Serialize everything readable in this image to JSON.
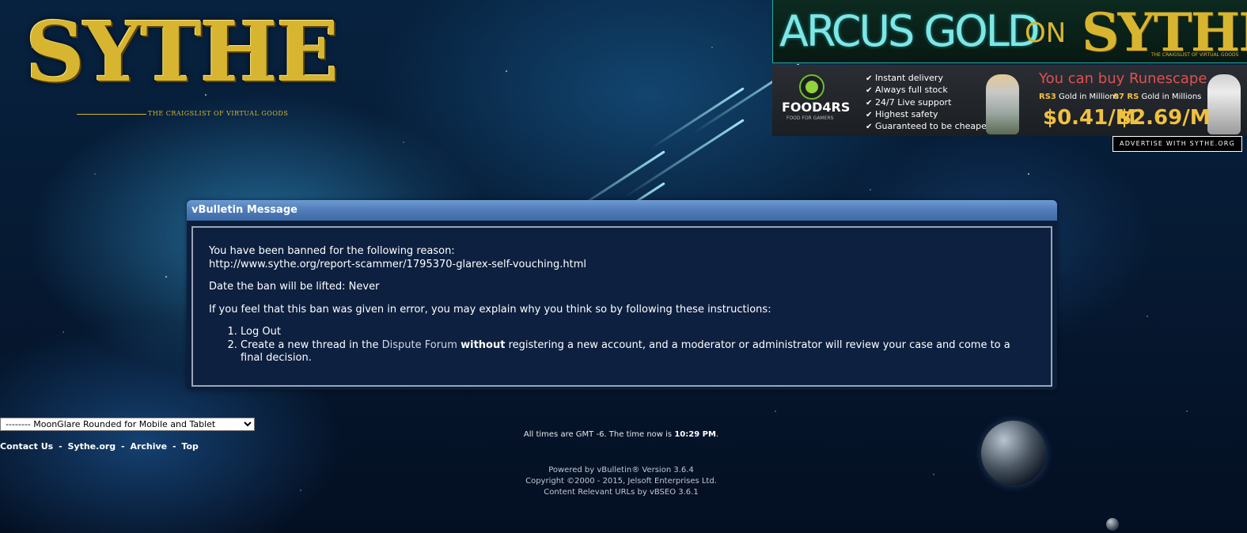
{
  "logo": {
    "word": "SYTHE",
    "tagline": "THE CRAIGSLIST OF VIRTUAL GOODS"
  },
  "ads": {
    "top_banner": {
      "arcus": "ARCUS GOLD",
      "on": "ON",
      "sythe": "SYTHE",
      "sythe_tag": "THE CRAIGSLIST OF VIRTUAL GOODS"
    },
    "bottom_banner": {
      "brand": "FOOD4RS",
      "brand_sub": "FOOD FOR GAMERS",
      "features": [
        "Instant delivery",
        "Always full stock",
        "24/7 Live support",
        "Highest safety",
        "Guaranteed to be cheapest"
      ],
      "headline": "You can buy Runescape",
      "rs3_prefix": "RS3",
      "rs3_label": " Gold in Millions",
      "rs3_price": "$0.41/M",
      "o7_prefix": "07 RS",
      "o7_label": " Gold in Millions",
      "o7_price": "$2.69/M"
    },
    "advertise_label": "ADVERTISE WITH SYTHE.ORG"
  },
  "message": {
    "title": "vBulletin Message",
    "line1": "You have been banned for the following reason:",
    "line2": "http://www.sythe.org/report-scammer/1795370-glarex-self-vouching.html",
    "date_line": "Date the ban will be lifted: Never",
    "instructions": "If you feel that this ban was given in error, you may explain why you think so by following these instructions:",
    "step1": "Log Out",
    "step2_pre": "Create a new thread in the ",
    "step2_link": "Dispute Forum",
    "step2_bold": "without",
    "step2_post": " registering a new account, and a moderator or administrator will review your case and come to a final decision."
  },
  "style_select": {
    "selected": "-------- MoonGlare Rounded for Mobile and Tablet"
  },
  "bottom_links": {
    "contact": "Contact Us",
    "sythe": "Sythe.org",
    "archive": "Archive",
    "top": "Top",
    "separator": "-"
  },
  "footer": {
    "time_pre": "All times are GMT -6. The time now is ",
    "time_value": "10:29 PM",
    "time_post": ".",
    "powered": "Powered by vBulletin® Version 3.6.4",
    "copyright": "Copyright ©2000 - 2015, Jelsoft Enterprises Ltd.",
    "vbseo": "Content Relevant URLs by vBSEO 3.6.1"
  }
}
